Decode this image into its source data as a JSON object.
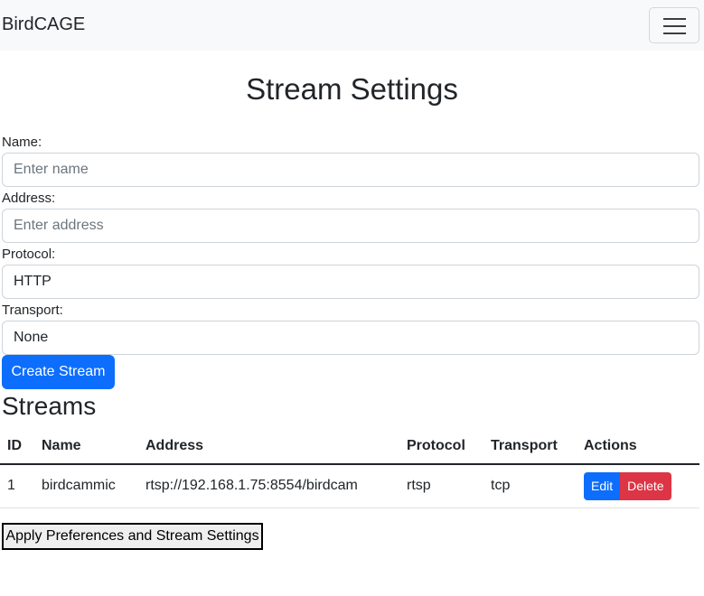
{
  "navbar": {
    "brand": "BirdCAGE",
    "toggler_icon": "hamburger-icon"
  },
  "page_title": "Stream Settings",
  "form": {
    "name_label": "Name:",
    "name_placeholder": "Enter name",
    "name_value": "",
    "address_label": "Address:",
    "address_placeholder": "Enter address",
    "address_value": "",
    "protocol_label": "Protocol:",
    "protocol_value": "HTTP",
    "transport_label": "Transport:",
    "transport_value": "None",
    "create_button": "Create Stream"
  },
  "streams": {
    "title": "Streams",
    "columns": [
      "ID",
      "Name",
      "Address",
      "Protocol",
      "Transport",
      "Actions"
    ],
    "rows": [
      {
        "id": "1",
        "name": "birdcammic",
        "address": "rtsp://192.168.1.75:8554/birdcam",
        "protocol": "rtsp",
        "transport": "tcp",
        "edit_label": "Edit",
        "delete_label": "Delete"
      }
    ]
  },
  "apply_button": "Apply Preferences and Stream Settings",
  "colors": {
    "primary": "#0d6efd",
    "danger": "#dc3545",
    "navbar_bg": "#f8f9fa"
  }
}
